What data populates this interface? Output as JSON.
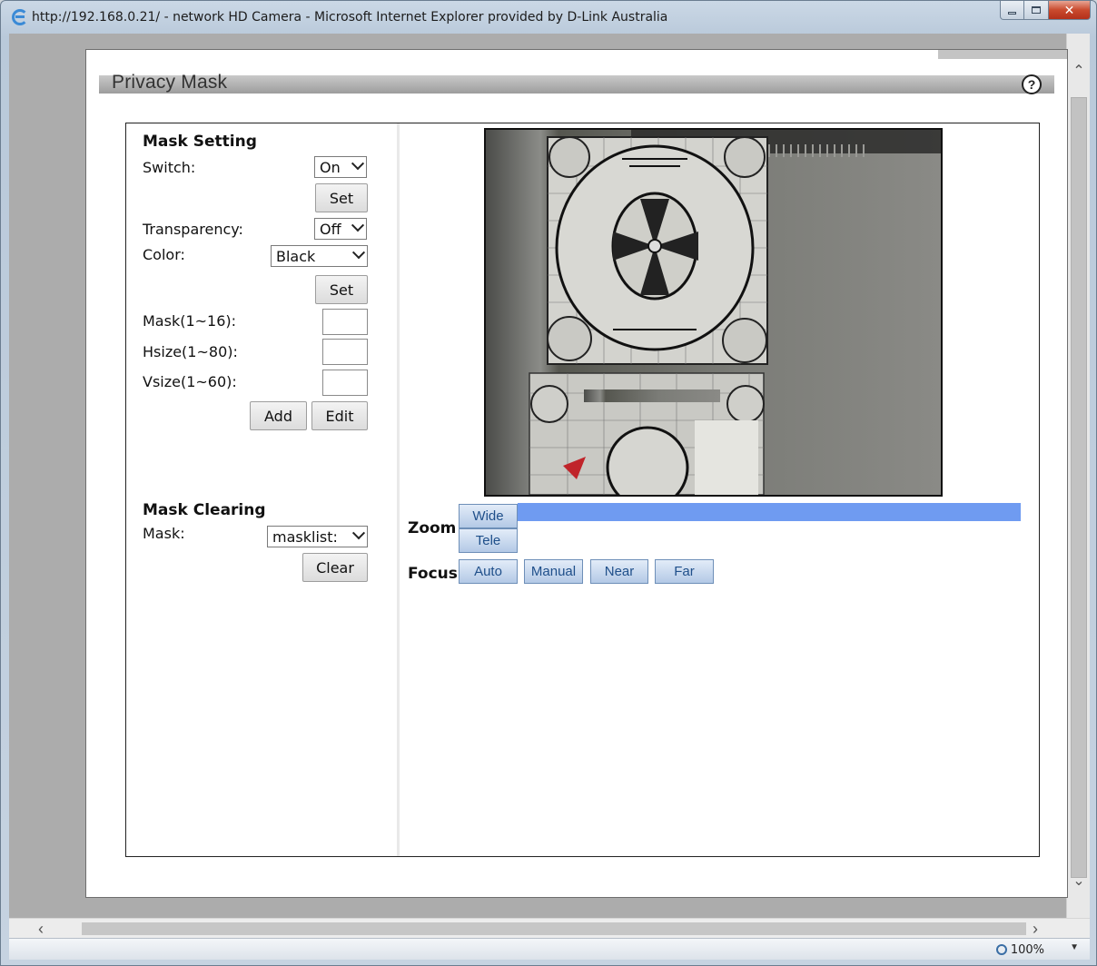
{
  "window": {
    "title": "http://192.168.0.21/ - network HD Camera - Microsoft Internet Explorer provided by D-Link Australia"
  },
  "header": {
    "title": "Privacy Mask",
    "help": "?"
  },
  "mask_setting": {
    "title": "Mask Setting",
    "switch_label": "Switch:",
    "switch_value": "On",
    "set_label": "Set",
    "transparency_label": "Transparency:",
    "transparency_value": "Off",
    "color_label": "Color:",
    "color_value": "Black",
    "set2_label": "Set",
    "mask_label": "Mask(1~16):",
    "hsize_label": "Hsize(1~80):",
    "vsize_label": "Vsize(1~60):",
    "add_label": "Add",
    "edit_label": "Edit"
  },
  "mask_clearing": {
    "title": "Mask Clearing",
    "mask_label": "Mask:",
    "mask_value": "masklist:",
    "clear_label": "Clear"
  },
  "ptz": {
    "zoom_label": "Zoom",
    "wide_label": "Wide",
    "tele_label": "Tele",
    "focus_label": "Focus",
    "auto_label": "Auto",
    "manual_label": "Manual",
    "near_label": "Near",
    "far_label": "Far"
  },
  "status": {
    "zoom": "100%"
  },
  "colors": {
    "zoom_bar": "#6f9bf1",
    "ptz_text": "#1f4f8a",
    "header_bar": "#b0b0b0"
  }
}
